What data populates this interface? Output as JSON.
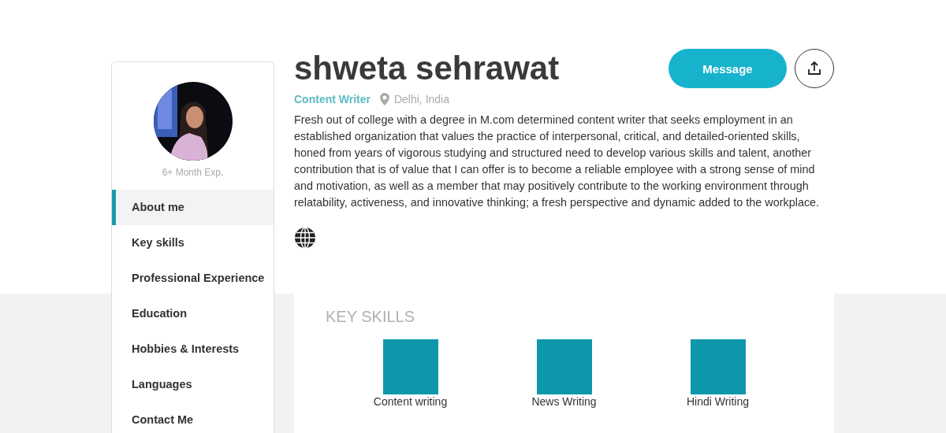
{
  "profile": {
    "experience": "6+ Month Exp.",
    "name": "shweta sehrawat",
    "role": "Content Writer",
    "location": "Delhi, India",
    "summary": "Fresh out of college with a degree in M.com determined content writer that seeks employment in an established organization that values the practice of interpersonal, critical, and detailed-oriented skills, honed from years of vigorous studying and structured need to develop various skills and talent, another contribution that is of value that I can offer is to become a reliable employee with a strong sense of mind and motivation, as well as a member that may positively contribute to the working environment through relatability, activeness, and innovative thinking; a fresh perspective and dynamic added to the workplace."
  },
  "actions": {
    "message": "Message"
  },
  "sidebar": {
    "items": [
      {
        "label": "About me",
        "selected": true
      },
      {
        "label": "Key skills",
        "selected": false
      },
      {
        "label": "Professional Experience",
        "selected": false
      },
      {
        "label": "Education",
        "selected": false
      },
      {
        "label": "Hobbies & Interests",
        "selected": false
      },
      {
        "label": "Languages",
        "selected": false
      },
      {
        "label": "Contact Me",
        "selected": false
      }
    ]
  },
  "key_skills": {
    "title": "KEY SKILLS",
    "skills": [
      {
        "label": "Content writing"
      },
      {
        "label": "News Writing"
      },
      {
        "label": "Hindi Writing"
      }
    ]
  }
}
